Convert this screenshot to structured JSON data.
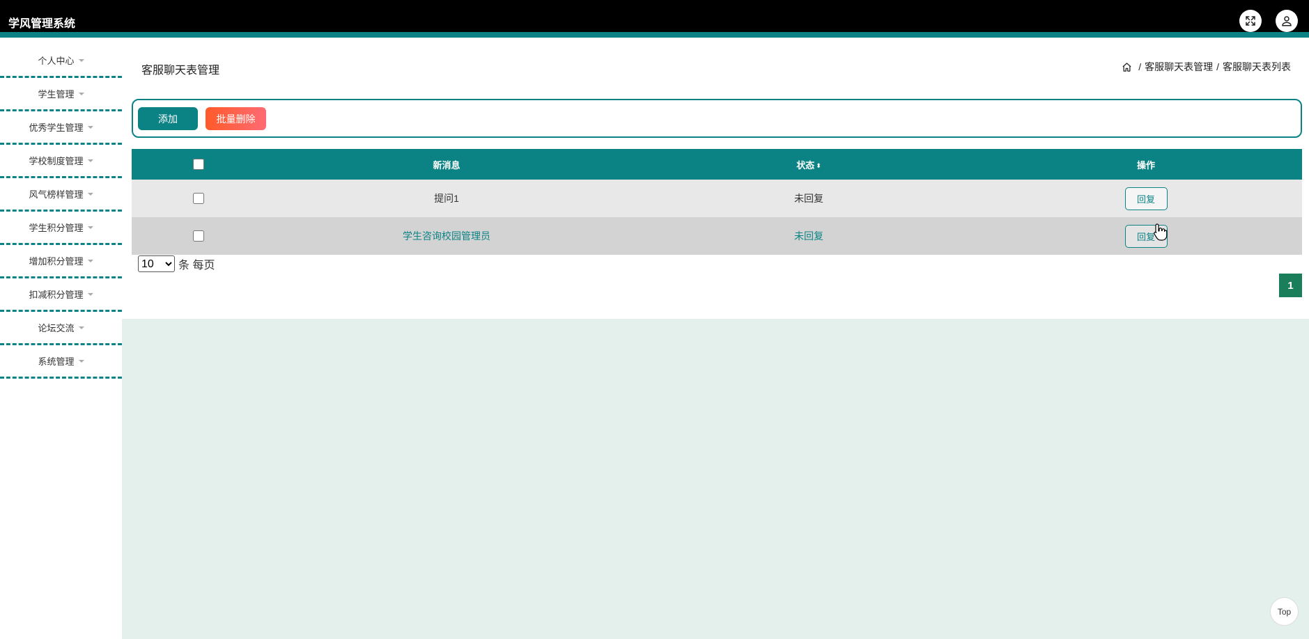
{
  "header": {
    "app_title": "学风管理系统",
    "fullscreen_icon": "expand-icon",
    "user_icon": "user-icon"
  },
  "sidebar": {
    "items": [
      {
        "label": "个人中心"
      },
      {
        "label": "学生管理"
      },
      {
        "label": "优秀学生管理"
      },
      {
        "label": "学校制度管理"
      },
      {
        "label": "风气榜样管理"
      },
      {
        "label": "学生积分管理"
      },
      {
        "label": "增加积分管理"
      },
      {
        "label": "扣减积分管理"
      },
      {
        "label": "论坛交流"
      },
      {
        "label": "系统管理"
      }
    ]
  },
  "main": {
    "page_title": "客服聊天表管理",
    "breadcrumb": {
      "home_icon": "home-icon",
      "separator": "/",
      "level1": "客服聊天表管理",
      "level2": "客服聊天表列表"
    },
    "toolbar": {
      "add_label": "添加",
      "batch_delete_label": "批量删除"
    },
    "table": {
      "columns": {
        "message": "新消息",
        "status": "状态",
        "operation": "操作"
      },
      "rows": [
        {
          "message": "提问1",
          "status": "未回复",
          "action": "回复"
        },
        {
          "message": "学生咨询校园管理员",
          "status": "未回复",
          "action": "回复"
        }
      ]
    },
    "pagination": {
      "page_size": "10",
      "page_size_options": [
        "10"
      ],
      "page_size_suffix": "条 每页",
      "current_page": "1"
    }
  },
  "back_to_top": "Top",
  "colors": {
    "primary": "#0b8385",
    "danger_gradient_start": "#ff5a2a",
    "danger_gradient_end": "#ff6b73",
    "page_active": "#1a7e5a",
    "content_bg": "#e3f0ec"
  }
}
